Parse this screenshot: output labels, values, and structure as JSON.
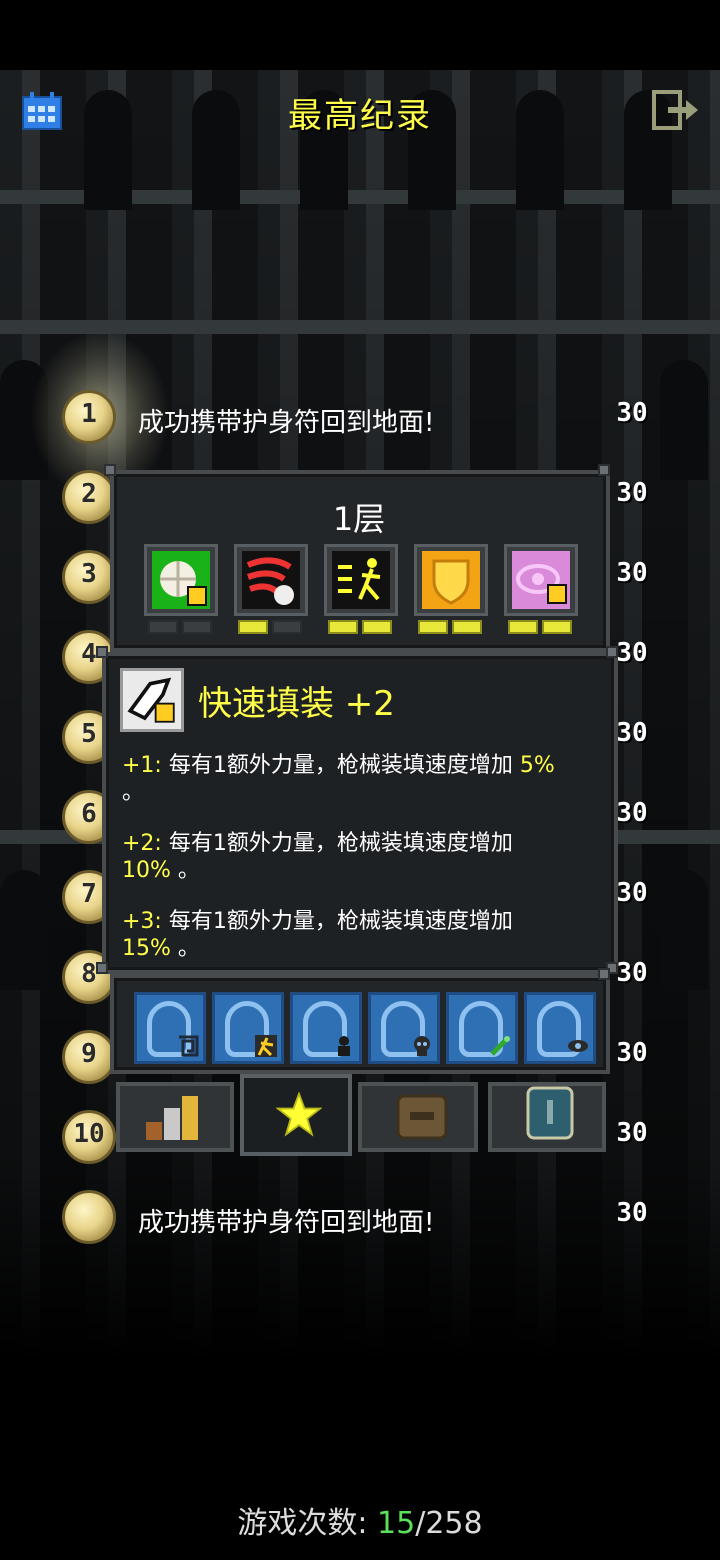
{
  "header": {
    "title": "最高纪录",
    "calendar_icon": "calendar-icon",
    "exit_icon": "exit-icon"
  },
  "rankings": [
    {
      "rank": "1",
      "text": "成功携带护身符回到地面!",
      "depth": "30"
    },
    {
      "rank": "2",
      "text": "",
      "depth": "30"
    },
    {
      "rank": "3",
      "text": "",
      "depth": "30"
    },
    {
      "rank": "4",
      "text": "",
      "depth": "30"
    },
    {
      "rank": "5",
      "text": "",
      "depth": "30"
    },
    {
      "rank": "6",
      "text": "",
      "depth": "30"
    },
    {
      "rank": "7",
      "text": "",
      "depth": "30"
    },
    {
      "rank": "8",
      "text": "",
      "depth": "30"
    },
    {
      "rank": "9",
      "text": "",
      "depth": "30"
    },
    {
      "rank": "10",
      "text": "",
      "depth": "30"
    },
    {
      "rank": "",
      "text": "成功携带护身符回到地面!",
      "depth": "30"
    }
  ],
  "talents_panel": {
    "floor_label": "1层",
    "talents": [
      {
        "name": "talent-hearty-meal",
        "color": "#19b319",
        "pips": [
          0,
          0
        ]
      },
      {
        "name": "talent-veterans-intuition",
        "color": "#111111",
        "pips": [
          1,
          0
        ]
      },
      {
        "name": "talent-test-subject",
        "color": "#111111",
        "pips": [
          1,
          1
        ]
      },
      {
        "name": "talent-iron-will",
        "color": "#f2a414",
        "pips": [
          1,
          1
        ]
      },
      {
        "name": "talent-scholars-intuition",
        "color": "#d98ad9",
        "pips": [
          1,
          1
        ]
      }
    ]
  },
  "talent_info": {
    "title": "快速填装 +2",
    "lines": [
      {
        "prefix": "+1:",
        "text": "每有1额外力量，枪械装填速度增加",
        "value": "5%",
        "suffix": "。"
      },
      {
        "prefix": "+2:",
        "text": "每有1额外力量，枪械装填速度增加",
        "value": "10%",
        "suffix": "。"
      },
      {
        "prefix": "+3:",
        "text": "每有1额外力量，枪械装填速度增加",
        "value": "15%",
        "suffix": "。"
      }
    ]
  },
  "sub_talents": [
    {
      "mark": "square-spiral-icon"
    },
    {
      "mark": "runner-icon"
    },
    {
      "mark": "dark-figure-icon"
    },
    {
      "mark": "skull-icon"
    },
    {
      "mark": "wand-icon"
    },
    {
      "mark": "eye-icon"
    }
  ],
  "tabs": [
    {
      "name": "stats-tab"
    },
    {
      "name": "talents-tab",
      "active": true
    },
    {
      "name": "items-tab"
    },
    {
      "name": "badges-tab"
    }
  ],
  "footer": {
    "label": "游戏次数:",
    "wins": "15",
    "separator": "/",
    "total": "258"
  }
}
